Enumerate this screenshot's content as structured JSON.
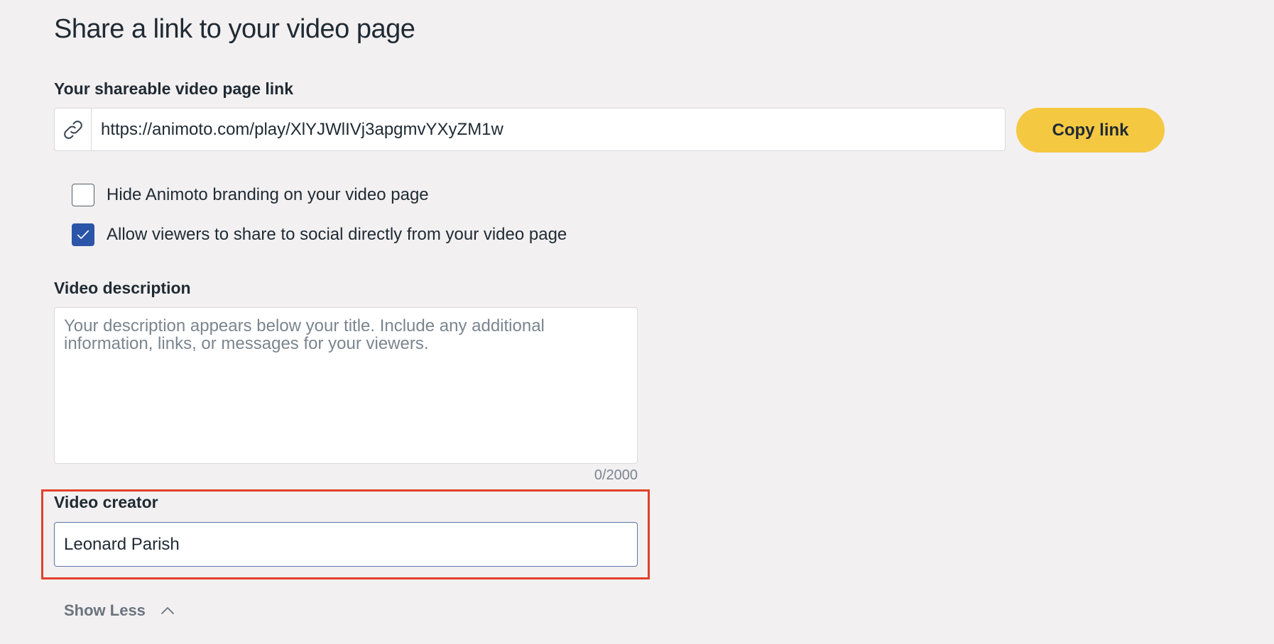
{
  "share": {
    "heading": "Share a link to your video page",
    "link_label": "Your shareable video page link",
    "link_url": "https://animoto.com/play/XlYJWlIVj3apgmvYXyZM1w",
    "copy_label": "Copy link",
    "accent_color": "#f5c842"
  },
  "options": [
    {
      "label": "Hide Animoto branding on your video page",
      "checked": false
    },
    {
      "label": "Allow viewers to share to social directly from your video page",
      "checked": true
    }
  ],
  "description": {
    "label": "Video description",
    "value": "",
    "placeholder": "Your description appears below your title. Include any additional information, links, or messages for your viewers.",
    "count": "0/2000"
  },
  "creator": {
    "label": "Video creator",
    "value": "Leonard Parish"
  },
  "toggle": {
    "label": "Show Less"
  }
}
